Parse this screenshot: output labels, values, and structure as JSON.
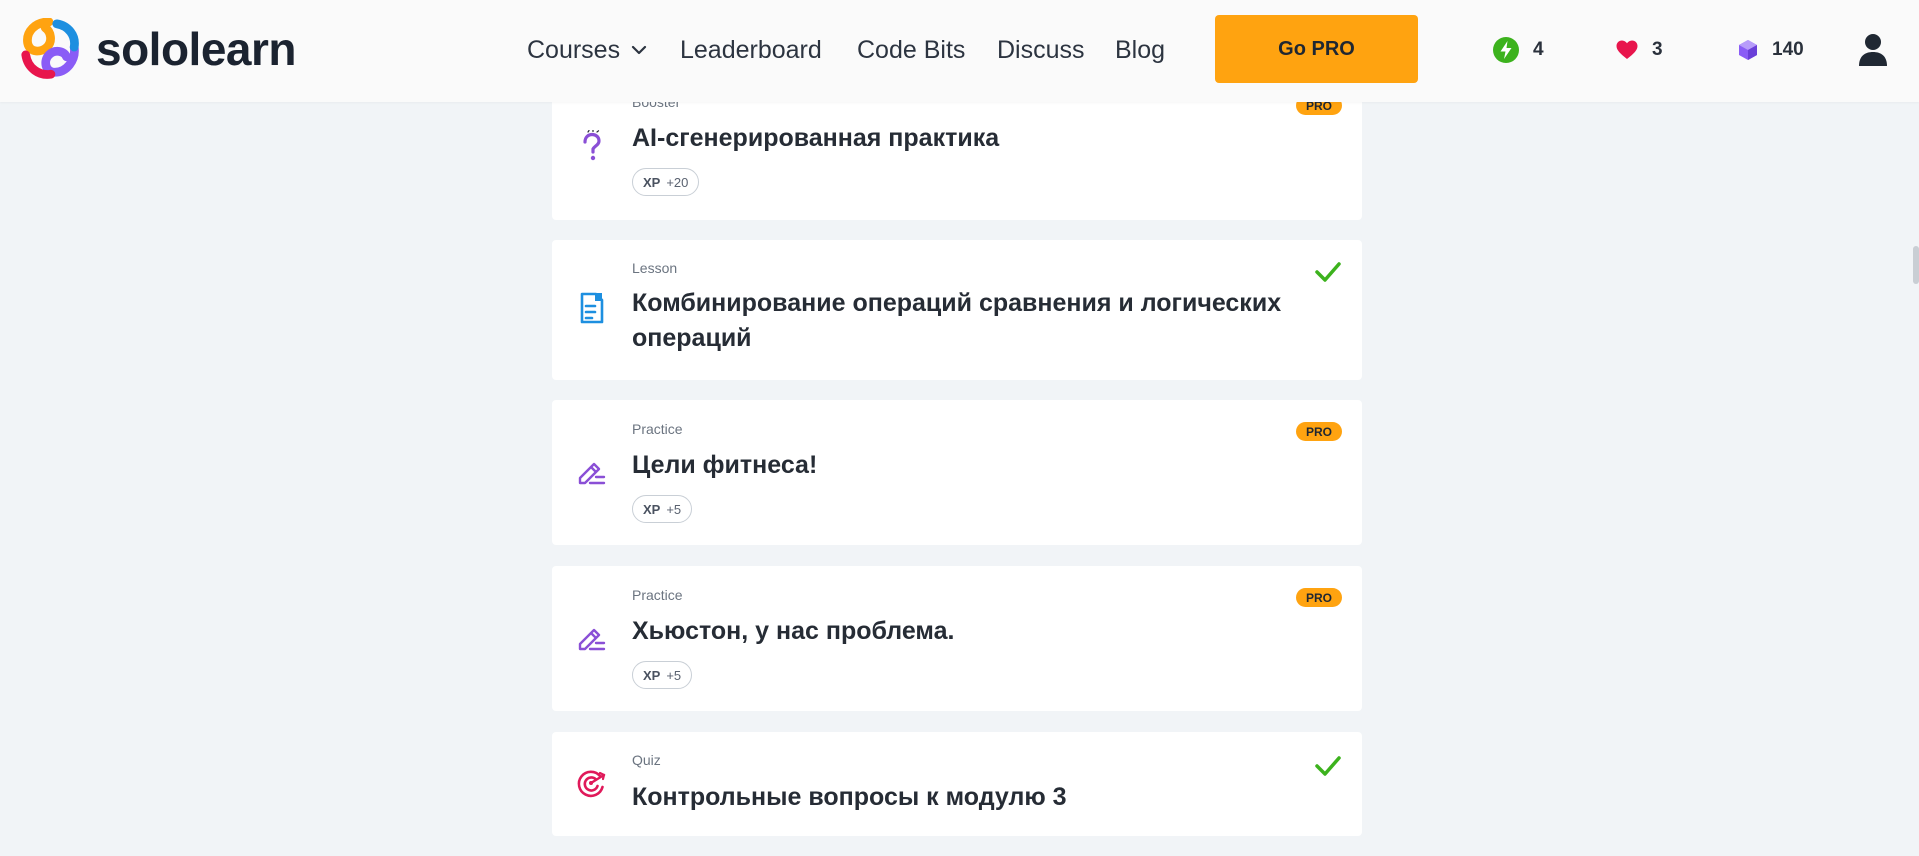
{
  "header": {
    "brand": "sololearn",
    "nav": {
      "courses": "Courses",
      "leaderboard": "Leaderboard",
      "code_bits": "Code Bits",
      "discuss": "Discuss",
      "blog": "Blog"
    },
    "go_pro": "Go PRO",
    "stats": {
      "streak": "4",
      "hearts": "3",
      "gems": "140"
    },
    "icons": [
      "lightning-icon",
      "heart-icon",
      "gem-icon",
      "user-icon",
      "chevron-down-icon"
    ]
  },
  "colors": {
    "accent_orange": "#ffa310",
    "check_green": "#3cb21d",
    "streak_green": "#3cb21d",
    "heart_red": "#e8154c",
    "gem_purple": "#8a5cf6",
    "practice_purple": "#8a4fd6",
    "lesson_blue": "#1d8fe0",
    "quiz_pink": "#e0195a",
    "page_bg": "#f1f4f7"
  },
  "cards": [
    {
      "type": "Booster",
      "title": "AI-сгенерированная практика",
      "xp_label": "XP",
      "xp_value": "+20",
      "badge": "PRO",
      "icon": "question-mark-icon",
      "completed": false
    },
    {
      "type": "Lesson",
      "title": "Комбинирование операций сравнения и логических операций",
      "icon": "document-icon",
      "completed": true
    },
    {
      "type": "Practice",
      "title": "Цели фитнеса!",
      "xp_label": "XP",
      "xp_value": "+5",
      "badge": "PRO",
      "icon": "pencil-icon",
      "completed": false
    },
    {
      "type": "Practice",
      "title": "Хьюстон, у нас проблема.",
      "xp_label": "XP",
      "xp_value": "+5",
      "badge": "PRO",
      "icon": "pencil-icon",
      "completed": false
    },
    {
      "type": "Quiz",
      "title": "Контрольные вопросы к модулю 3",
      "icon": "target-icon",
      "completed": true
    }
  ]
}
